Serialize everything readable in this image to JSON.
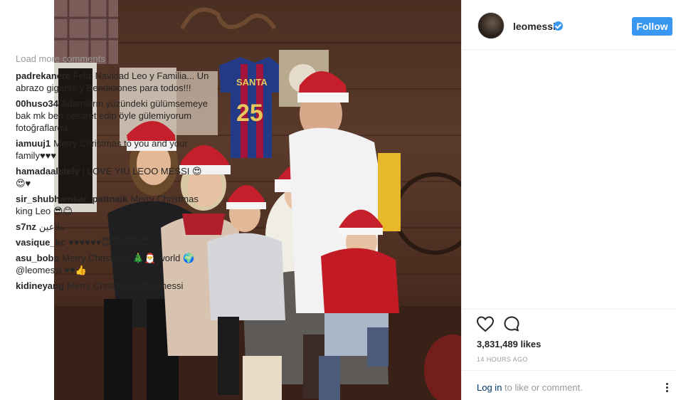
{
  "post": {
    "username": "leomessi",
    "follow_label": "Follow",
    "load_more": "Load more comments",
    "likes": "3,831,489 likes",
    "time_ago": "14 HOURS AGO",
    "login_link": "Log in",
    "login_suffix": " to like or comment.",
    "jersey_name": "SANTA",
    "jersey_number": "25"
  },
  "comments": [
    {
      "user": "padrekanete",
      "text": "Feliz Navidad Leo y Familia... Un abrazo gigante y Bendiciones para todos!!!"
    },
    {
      "user": "00huso34",
      "text": "Adamların yüzündeki gülümsemeye bak mk ben cesaret edip öyle gülemiyorum fotoğraflarda"
    },
    {
      "user": "iamuuj1",
      "text": "Merry Christmas to you and your family♥♥♥"
    },
    {
      "user": "hamadaalstely",
      "text": "I LOVE YIU LEOO MESSI 😍😍♥"
    },
    {
      "user": "sir_shubhamkar_pattnaik",
      "text": "Merry Christmas king Leo 😎😊"
    },
    {
      "user": "s7nz",
      "text": "ملاعين"
    },
    {
      "user": "vasique_kc",
      "text": "♥♥♥♥♥♥😇😇😇😇😇"
    },
    {
      "user": "asu_bobo",
      "text": "Merry Christmas 🎄🎅 world 🌍 @leomessi ♥♥👍"
    },
    {
      "user": "kidineyang",
      "text": "Merry Christmas @leomessi"
    }
  ],
  "colors": {
    "accent": "#3897f0",
    "muted": "#999999",
    "text": "#262626",
    "link": "#003569"
  },
  "icons": [
    "heart-icon",
    "comment-icon",
    "verified-icon",
    "more-options-icon"
  ]
}
